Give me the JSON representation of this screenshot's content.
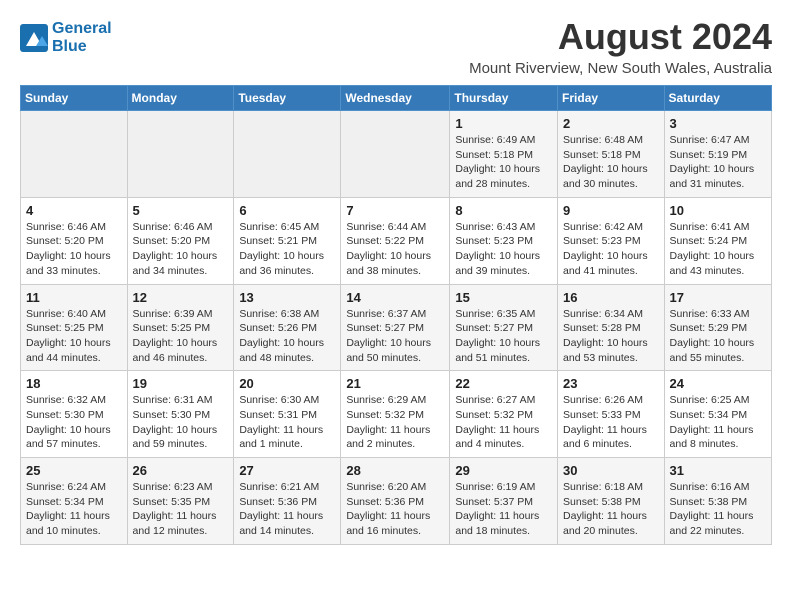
{
  "logo": {
    "line1": "General",
    "line2": "Blue"
  },
  "title": "August 2024",
  "location": "Mount Riverview, New South Wales, Australia",
  "weekdays": [
    "Sunday",
    "Monday",
    "Tuesday",
    "Wednesday",
    "Thursday",
    "Friday",
    "Saturday"
  ],
  "weeks": [
    [
      {
        "day": "",
        "sunrise": "",
        "sunset": "",
        "daylight": ""
      },
      {
        "day": "",
        "sunrise": "",
        "sunset": "",
        "daylight": ""
      },
      {
        "day": "",
        "sunrise": "",
        "sunset": "",
        "daylight": ""
      },
      {
        "day": "",
        "sunrise": "",
        "sunset": "",
        "daylight": ""
      },
      {
        "day": "1",
        "sunrise": "Sunrise: 6:49 AM",
        "sunset": "Sunset: 5:18 PM",
        "daylight": "Daylight: 10 hours and 28 minutes."
      },
      {
        "day": "2",
        "sunrise": "Sunrise: 6:48 AM",
        "sunset": "Sunset: 5:18 PM",
        "daylight": "Daylight: 10 hours and 30 minutes."
      },
      {
        "day": "3",
        "sunrise": "Sunrise: 6:47 AM",
        "sunset": "Sunset: 5:19 PM",
        "daylight": "Daylight: 10 hours and 31 minutes."
      }
    ],
    [
      {
        "day": "4",
        "sunrise": "Sunrise: 6:46 AM",
        "sunset": "Sunset: 5:20 PM",
        "daylight": "Daylight: 10 hours and 33 minutes."
      },
      {
        "day": "5",
        "sunrise": "Sunrise: 6:46 AM",
        "sunset": "Sunset: 5:20 PM",
        "daylight": "Daylight: 10 hours and 34 minutes."
      },
      {
        "day": "6",
        "sunrise": "Sunrise: 6:45 AM",
        "sunset": "Sunset: 5:21 PM",
        "daylight": "Daylight: 10 hours and 36 minutes."
      },
      {
        "day": "7",
        "sunrise": "Sunrise: 6:44 AM",
        "sunset": "Sunset: 5:22 PM",
        "daylight": "Daylight: 10 hours and 38 minutes."
      },
      {
        "day": "8",
        "sunrise": "Sunrise: 6:43 AM",
        "sunset": "Sunset: 5:23 PM",
        "daylight": "Daylight: 10 hours and 39 minutes."
      },
      {
        "day": "9",
        "sunrise": "Sunrise: 6:42 AM",
        "sunset": "Sunset: 5:23 PM",
        "daylight": "Daylight: 10 hours and 41 minutes."
      },
      {
        "day": "10",
        "sunrise": "Sunrise: 6:41 AM",
        "sunset": "Sunset: 5:24 PM",
        "daylight": "Daylight: 10 hours and 43 minutes."
      }
    ],
    [
      {
        "day": "11",
        "sunrise": "Sunrise: 6:40 AM",
        "sunset": "Sunset: 5:25 PM",
        "daylight": "Daylight: 10 hours and 44 minutes."
      },
      {
        "day": "12",
        "sunrise": "Sunrise: 6:39 AM",
        "sunset": "Sunset: 5:25 PM",
        "daylight": "Daylight: 10 hours and 46 minutes."
      },
      {
        "day": "13",
        "sunrise": "Sunrise: 6:38 AM",
        "sunset": "Sunset: 5:26 PM",
        "daylight": "Daylight: 10 hours and 48 minutes."
      },
      {
        "day": "14",
        "sunrise": "Sunrise: 6:37 AM",
        "sunset": "Sunset: 5:27 PM",
        "daylight": "Daylight: 10 hours and 50 minutes."
      },
      {
        "day": "15",
        "sunrise": "Sunrise: 6:35 AM",
        "sunset": "Sunset: 5:27 PM",
        "daylight": "Daylight: 10 hours and 51 minutes."
      },
      {
        "day": "16",
        "sunrise": "Sunrise: 6:34 AM",
        "sunset": "Sunset: 5:28 PM",
        "daylight": "Daylight: 10 hours and 53 minutes."
      },
      {
        "day": "17",
        "sunrise": "Sunrise: 6:33 AM",
        "sunset": "Sunset: 5:29 PM",
        "daylight": "Daylight: 10 hours and 55 minutes."
      }
    ],
    [
      {
        "day": "18",
        "sunrise": "Sunrise: 6:32 AM",
        "sunset": "Sunset: 5:30 PM",
        "daylight": "Daylight: 10 hours and 57 minutes."
      },
      {
        "day": "19",
        "sunrise": "Sunrise: 6:31 AM",
        "sunset": "Sunset: 5:30 PM",
        "daylight": "Daylight: 10 hours and 59 minutes."
      },
      {
        "day": "20",
        "sunrise": "Sunrise: 6:30 AM",
        "sunset": "Sunset: 5:31 PM",
        "daylight": "Daylight: 11 hours and 1 minute."
      },
      {
        "day": "21",
        "sunrise": "Sunrise: 6:29 AM",
        "sunset": "Sunset: 5:32 PM",
        "daylight": "Daylight: 11 hours and 2 minutes."
      },
      {
        "day": "22",
        "sunrise": "Sunrise: 6:27 AM",
        "sunset": "Sunset: 5:32 PM",
        "daylight": "Daylight: 11 hours and 4 minutes."
      },
      {
        "day": "23",
        "sunrise": "Sunrise: 6:26 AM",
        "sunset": "Sunset: 5:33 PM",
        "daylight": "Daylight: 11 hours and 6 minutes."
      },
      {
        "day": "24",
        "sunrise": "Sunrise: 6:25 AM",
        "sunset": "Sunset: 5:34 PM",
        "daylight": "Daylight: 11 hours and 8 minutes."
      }
    ],
    [
      {
        "day": "25",
        "sunrise": "Sunrise: 6:24 AM",
        "sunset": "Sunset: 5:34 PM",
        "daylight": "Daylight: 11 hours and 10 minutes."
      },
      {
        "day": "26",
        "sunrise": "Sunrise: 6:23 AM",
        "sunset": "Sunset: 5:35 PM",
        "daylight": "Daylight: 11 hours and 12 minutes."
      },
      {
        "day": "27",
        "sunrise": "Sunrise: 6:21 AM",
        "sunset": "Sunset: 5:36 PM",
        "daylight": "Daylight: 11 hours and 14 minutes."
      },
      {
        "day": "28",
        "sunrise": "Sunrise: 6:20 AM",
        "sunset": "Sunset: 5:36 PM",
        "daylight": "Daylight: 11 hours and 16 minutes."
      },
      {
        "day": "29",
        "sunrise": "Sunrise: 6:19 AM",
        "sunset": "Sunset: 5:37 PM",
        "daylight": "Daylight: 11 hours and 18 minutes."
      },
      {
        "day": "30",
        "sunrise": "Sunrise: 6:18 AM",
        "sunset": "Sunset: 5:38 PM",
        "daylight": "Daylight: 11 hours and 20 minutes."
      },
      {
        "day": "31",
        "sunrise": "Sunrise: 6:16 AM",
        "sunset": "Sunset: 5:38 PM",
        "daylight": "Daylight: 11 hours and 22 minutes."
      }
    ]
  ]
}
